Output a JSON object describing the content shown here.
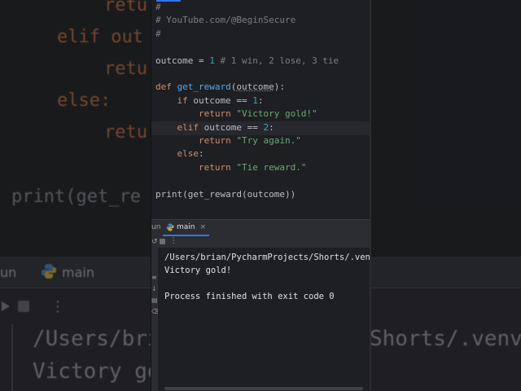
{
  "editor": {
    "lines": [
      [
        {
          "t": "#",
          "c": "com"
        }
      ],
      [
        {
          "t": "# YouTube.com/@BeginSecure",
          "c": "com"
        }
      ],
      [
        {
          "t": "#",
          "c": "com"
        }
      ],
      [],
      [
        {
          "t": "outcome",
          "c": "var"
        },
        {
          "t": " = ",
          "c": "var"
        },
        {
          "t": "1",
          "c": "num"
        },
        {
          "t": " # 1 win, 2 lose, 3 tie",
          "c": "com"
        }
      ],
      [],
      [
        {
          "t": "def ",
          "c": "kw"
        },
        {
          "t": "get_reward",
          "c": "fn"
        },
        {
          "t": "(",
          "c": "var"
        },
        {
          "t": "outcome",
          "c": "param"
        },
        {
          "t": "):",
          "c": "var"
        }
      ],
      [
        {
          "t": "    if ",
          "c": "kw"
        },
        {
          "t": "outcome ",
          "c": "var"
        },
        {
          "t": "== ",
          "c": "var"
        },
        {
          "t": "1",
          "c": "num"
        },
        {
          "t": ":",
          "c": "var"
        }
      ],
      [
        {
          "t": "        return ",
          "c": "kw"
        },
        {
          "t": "\"Victory gold!\"",
          "c": "str"
        }
      ],
      [
        {
          "t": "    elif ",
          "c": "kw"
        },
        {
          "t": "outcome ",
          "c": "var"
        },
        {
          "t": "== ",
          "c": "var"
        },
        {
          "t": "2",
          "c": "num"
        },
        {
          "t": ":",
          "c": "var"
        }
      ],
      [
        {
          "t": "        return ",
          "c": "kw"
        },
        {
          "t": "\"Try again.\"",
          "c": "str"
        }
      ],
      [
        {
          "t": "    else",
          "c": "kw"
        },
        {
          "t": ":",
          "c": "var"
        }
      ],
      [
        {
          "t": "        return ",
          "c": "kw"
        },
        {
          "t": "\"Tie reward.\"",
          "c": "str"
        }
      ],
      [],
      [
        {
          "t": "print",
          "c": "var"
        },
        {
          "t": "(",
          "c": "var"
        },
        {
          "t": "get_reward",
          "c": "var"
        },
        {
          "t": "(",
          "c": "var"
        },
        {
          "t": "outcome",
          "c": "var"
        },
        {
          "t": "))",
          "c": "var"
        }
      ]
    ]
  },
  "run_panel": {
    "label": "un",
    "tab_label": "main",
    "close_glyph": "×"
  },
  "console": {
    "lines": [
      "/Users/brian/PycharmProjects/Shorts/.venv/",
      "Victory gold!",
      "",
      "Process finished with exit code 0"
    ]
  },
  "background": {
    "code_lines": [
      {
        "t": "retu",
        "c": "kw"
      },
      {
        "t": "elif out",
        "c": "kw"
      },
      {
        "t": "retu",
        "c": "kw"
      },
      {
        "t": "else:",
        "c": "kw"
      },
      {
        "t": "retu",
        "c": "kw"
      },
      {
        "t": "print(get_re",
        "c": "tx"
      }
    ],
    "tab_label_run": "un",
    "tab_label_main": "main",
    "output_left": [
      "/Users/bria",
      "Victory gol"
    ],
    "output_right": "Shorts/.venv/"
  },
  "colors": {
    "keyword": "#cf8e6d",
    "function": "#56a8f5",
    "number": "#2aacb8",
    "string": "#6aab73",
    "comment": "#7a7e85",
    "text": "#bcbec4",
    "accent": "#3574f0"
  },
  "icons": {
    "python": "python-logo-icon",
    "rerun": "rerun-icon",
    "stop": "stop-icon",
    "more": "more-vertical-icon"
  }
}
